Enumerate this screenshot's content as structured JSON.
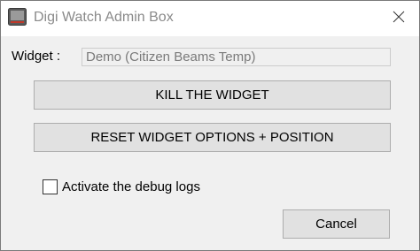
{
  "window": {
    "title": "Digi Watch Admin Box",
    "app_icon": "monitor-icon",
    "close_icon": "close-icon"
  },
  "widget": {
    "label": "Widget :",
    "value": "Demo (Citizen Beams Temp)"
  },
  "buttons": {
    "kill": "KILL THE WIDGET",
    "reset": "RESET WIDGET OPTIONS + POSITION",
    "cancel": "Cancel"
  },
  "debug": {
    "label": "Activate the debug logs",
    "checked": false
  },
  "colors": {
    "dialog_bg": "#f0f0f0",
    "button_bg": "#e1e1e1",
    "button_border": "#adadad",
    "title_text": "#8a8a8a"
  }
}
